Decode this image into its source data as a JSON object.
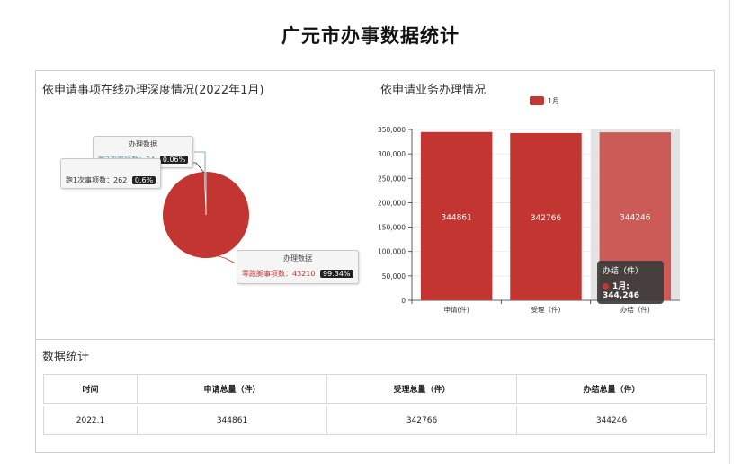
{
  "page_title": "广元市办事数据统计",
  "pie_panel": {
    "title": "依申请事项在线办理深度情况(2022年1月)",
    "labels": [
      {
        "header": "办理数据",
        "name": "跑2次事项数",
        "value": "24",
        "percent": "0.06%",
        "color": "#5b9aa6"
      },
      {
        "header": "",
        "name": "跑1次事项数",
        "value": "262",
        "percent": "0.6%",
        "color": "#333333"
      },
      {
        "header": "办理数据",
        "name": "零跑腿事项数",
        "value": "43210",
        "percent": "99.34%",
        "color": "#c23531"
      }
    ]
  },
  "bar_panel": {
    "title": "依申请业务办理情况",
    "legend_label": "1月",
    "tooltip": {
      "title": "办结（件）",
      "series": "1月",
      "value": "344,246"
    }
  },
  "colors": {
    "primary": "#c23531",
    "highlight": "#cc5a56",
    "ring": "#4d6b78"
  },
  "chart_data": [
    {
      "type": "pie",
      "title": "依申请事项在线办理深度情况(2022年1月)",
      "series_name": "办理数据",
      "slices": [
        {
          "label": "零跑腿事项数",
          "value": 43210,
          "percent": 99.34
        },
        {
          "label": "跑1次事项数",
          "value": 262,
          "percent": 0.6
        },
        {
          "label": "跑2次事项数",
          "value": 24,
          "percent": 0.06
        }
      ]
    },
    {
      "type": "bar",
      "title": "依申请业务办理情况",
      "categories": [
        "申请(件)",
        "受理（件)",
        "办结（件)"
      ],
      "series": [
        {
          "name": "1月",
          "values": [
            344861,
            342766,
            344246
          ]
        }
      ],
      "ylim": [
        0,
        350000
      ],
      "yticks": [
        "0",
        "50,000",
        "100,000",
        "150,000",
        "200,000",
        "250,000",
        "300,000",
        "350,000"
      ],
      "grid": true,
      "legend": "top-center"
    }
  ],
  "stats": {
    "title": "数据统计",
    "headers": [
      "时间",
      "申请总量（件）",
      "受理总量（件）",
      "办结总量（件）"
    ],
    "rows": [
      [
        "2022.1",
        "344861",
        "342766",
        "344246"
      ]
    ]
  }
}
